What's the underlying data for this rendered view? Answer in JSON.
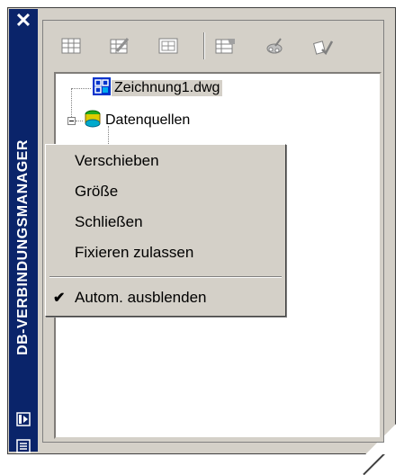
{
  "palette": {
    "title": "DB-VERBINDUNGSMANAGER",
    "close_glyph": "✕"
  },
  "toolbar": {
    "buttons": [
      {
        "icon": "view-table-icon"
      },
      {
        "icon": "edit-table-icon"
      },
      {
        "icon": "new-link-template-icon"
      },
      {
        "icon": "new-label-template-icon"
      },
      {
        "icon": "query-icon"
      },
      {
        "icon": "synchronize-icon"
      }
    ]
  },
  "tree": {
    "nodes": [
      {
        "label": "Zeichnung1.dwg",
        "icon": "drawing-icon",
        "selected": true
      },
      {
        "label": "Datenquellen",
        "icon": "data-sources-icon",
        "expanded": true
      }
    ]
  },
  "context_menu": {
    "items": [
      {
        "label": "Verschieben",
        "checked": false
      },
      {
        "label": "Größe",
        "checked": false
      },
      {
        "label": "Schließen",
        "checked": false
      },
      {
        "label": "Fixieren zulassen",
        "checked": false
      },
      {
        "label": "Autom. ausblenden",
        "checked": true
      }
    ],
    "check_glyph": "✔"
  },
  "colors": {
    "title_bar": "#0a246a",
    "face": "#d4d0c8"
  }
}
